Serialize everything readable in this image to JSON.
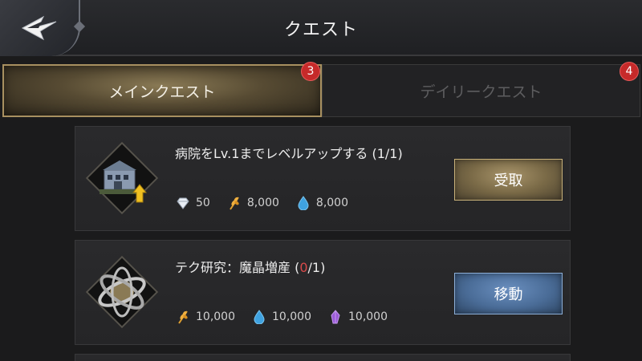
{
  "header": {
    "title": "クエスト"
  },
  "tabs": [
    {
      "label": "メインクエスト",
      "badge": "3",
      "active": true
    },
    {
      "label": "デイリークエスト",
      "badge": "4",
      "active": false
    }
  ],
  "quests": [
    {
      "title": "病院をLv.1までレベルアップする (1/1)",
      "icon": "hospital-building-icon",
      "rewards": [
        {
          "icon": "diamond-icon",
          "value": "50"
        },
        {
          "icon": "wheat-icon",
          "value": "8,000"
        },
        {
          "icon": "water-drop-icon",
          "value": "8,000"
        }
      ],
      "button": "受取"
    },
    {
      "title_prefix": "テク研究：魔晶増産 (",
      "progress_current": "0",
      "title_suffix": "/1)",
      "icon": "armillary-sphere-icon",
      "rewards": [
        {
          "icon": "wheat-icon",
          "value": "10,000"
        },
        {
          "icon": "water-drop-icon",
          "value": "10,000"
        },
        {
          "icon": "crystal-icon",
          "value": "10,000"
        }
      ],
      "button": "移動"
    }
  ],
  "colors": {
    "claim_button": "#8a7a55",
    "move_button": "#4a6c97",
    "badge": "#c62a2a",
    "progress_incomplete": "#d94a4a"
  }
}
